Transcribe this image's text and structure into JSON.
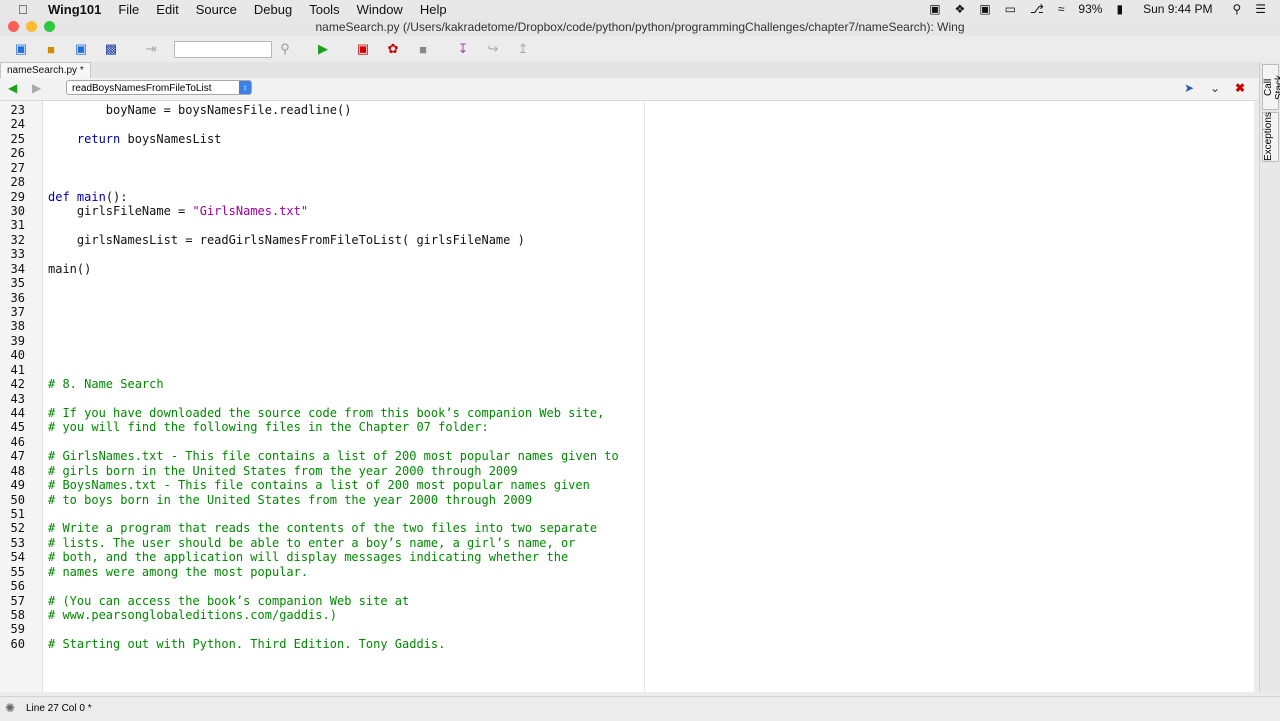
{
  "menubar": {
    "app_name": "Wing101",
    "items": [
      "File",
      "Edit",
      "Source",
      "Debug",
      "Tools",
      "Window",
      "Help"
    ],
    "battery": "93%",
    "clock": "Sun 9:44 PM"
  },
  "window": {
    "title": "nameSearch.py (/Users/kakradetome/Dropbox/code/python/python/programmingChallenges/chapter7/nameSearch): Wing"
  },
  "tab": {
    "label": "nameSearch.py *"
  },
  "scope": {
    "label": "readBoysNamesFromFileToList"
  },
  "side_tabs": {
    "call_stack": "Call Stack",
    "exceptions": "Exceptions"
  },
  "status": {
    "position": "Line 27 Col 0 *"
  },
  "code_lines": [
    {
      "n": "23",
      "parts": [
        {
          "c": "        boyName = boysNamesFile.readline()"
        }
      ]
    },
    {
      "n": "24",
      "parts": [
        {
          "c": ""
        }
      ]
    },
    {
      "n": "25",
      "parts": [
        {
          "c": "    "
        },
        {
          "k": "return"
        },
        {
          "c": " boysNamesList"
        }
      ]
    },
    {
      "n": "26",
      "parts": [
        {
          "c": ""
        }
      ]
    },
    {
      "n": "27",
      "parts": [
        {
          "c": ""
        }
      ]
    },
    {
      "n": "28",
      "parts": [
        {
          "c": ""
        }
      ]
    },
    {
      "n": "29",
      "parts": [
        {
          "k": "def"
        },
        {
          "c": " "
        },
        {
          "k": "main"
        },
        {
          "c": "():"
        }
      ]
    },
    {
      "n": "30",
      "parts": [
        {
          "c": "    girlsFileName = "
        },
        {
          "s": "\"GirlsNames.txt\""
        }
      ]
    },
    {
      "n": "31",
      "parts": [
        {
          "c": ""
        }
      ]
    },
    {
      "n": "32",
      "parts": [
        {
          "c": "    girlsNamesList = readGirlsNamesFromFileToList( girlsFileName )"
        }
      ]
    },
    {
      "n": "33",
      "parts": [
        {
          "c": ""
        }
      ]
    },
    {
      "n": "34",
      "parts": [
        {
          "c": "main()"
        }
      ]
    },
    {
      "n": "35",
      "parts": [
        {
          "c": ""
        }
      ]
    },
    {
      "n": "36",
      "parts": [
        {
          "c": ""
        }
      ]
    },
    {
      "n": "37",
      "parts": [
        {
          "c": ""
        }
      ]
    },
    {
      "n": "38",
      "parts": [
        {
          "c": ""
        }
      ]
    },
    {
      "n": "39",
      "parts": [
        {
          "c": ""
        }
      ]
    },
    {
      "n": "40",
      "parts": [
        {
          "c": ""
        }
      ]
    },
    {
      "n": "41",
      "parts": [
        {
          "c": ""
        }
      ]
    },
    {
      "n": "42",
      "parts": [
        {
          "m": "# 8. Name Search"
        }
      ]
    },
    {
      "n": "43",
      "parts": [
        {
          "c": ""
        }
      ]
    },
    {
      "n": "44",
      "parts": [
        {
          "m": "# If you have downloaded the source code from this book’s companion Web site,"
        }
      ]
    },
    {
      "n": "45",
      "parts": [
        {
          "m": "# you will find the following files in the Chapter 07 folder:"
        }
      ]
    },
    {
      "n": "46",
      "parts": [
        {
          "c": ""
        }
      ]
    },
    {
      "n": "47",
      "parts": [
        {
          "m": "# GirlsNames.txt - This file contains a list of 200 most popular names given to"
        }
      ]
    },
    {
      "n": "48",
      "parts": [
        {
          "m": "# girls born in the United States from the year 2000 through 2009"
        }
      ]
    },
    {
      "n": "49",
      "parts": [
        {
          "m": "# BoysNames.txt - This file contains a list of 200 most popular names given"
        }
      ]
    },
    {
      "n": "50",
      "parts": [
        {
          "m": "# to boys born in the United States from the year 2000 through 2009"
        }
      ]
    },
    {
      "n": "51",
      "parts": [
        {
          "c": ""
        }
      ]
    },
    {
      "n": "52",
      "parts": [
        {
          "m": "# Write a program that reads the contents of the two files into two separate"
        }
      ]
    },
    {
      "n": "53",
      "parts": [
        {
          "m": "# lists. The user should be able to enter a boy’s name, a girl’s name, or"
        }
      ]
    },
    {
      "n": "54",
      "parts": [
        {
          "m": "# both, and the application will display messages indicating whether the"
        }
      ]
    },
    {
      "n": "55",
      "parts": [
        {
          "m": "# names were among the most popular."
        }
      ]
    },
    {
      "n": "56",
      "parts": [
        {
          "c": ""
        }
      ]
    },
    {
      "n": "57",
      "parts": [
        {
          "m": "# (You can access the book’s companion Web site at"
        }
      ]
    },
    {
      "n": "58",
      "parts": [
        {
          "m": "# www.pearsonglobaleditions.com/gaddis.)"
        }
      ]
    },
    {
      "n": "59",
      "parts": [
        {
          "c": ""
        }
      ]
    },
    {
      "n": "60",
      "parts": [
        {
          "m": "# Starting out with Python. Third Edition. Tony Gaddis."
        }
      ]
    }
  ]
}
